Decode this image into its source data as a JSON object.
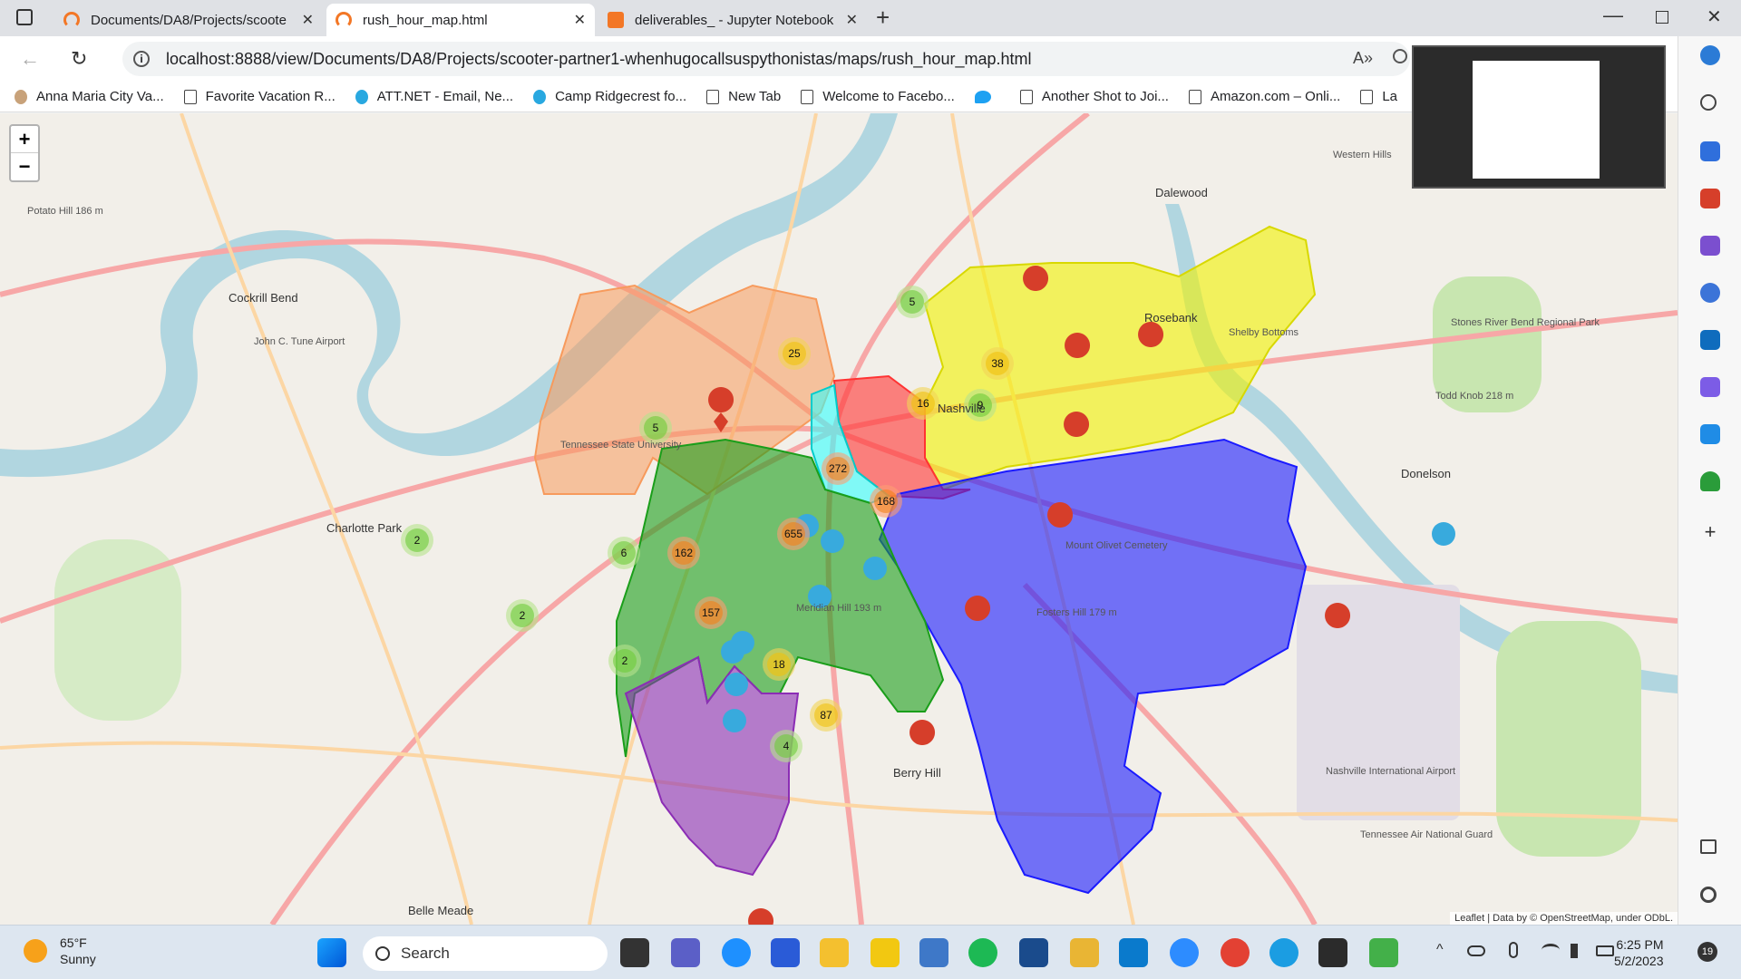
{
  "tabs": [
    {
      "label": "Documents/DA8/Projects/scoote",
      "active": false
    },
    {
      "label": "rush_hour_map.html",
      "active": true
    },
    {
      "label": "deliverables_ - Jupyter Notebook",
      "active": false
    }
  ],
  "address": {
    "url": "localhost:8888/view/Documents/DA8/Projects/scooter-partner1-whenhugocallsuspythonistas/maps/rush_hour_map.html"
  },
  "bookmarks": [
    {
      "label": "Anna Maria City Va...",
      "icon": "circle"
    },
    {
      "label": "Favorite Vacation R...",
      "icon": "page"
    },
    {
      "label": "ATT.NET - Email, Ne...",
      "icon": "globe"
    },
    {
      "label": "Camp Ridgecrest fo...",
      "icon": "globe"
    },
    {
      "label": "New Tab",
      "icon": "page"
    },
    {
      "label": "Welcome to Facebo...",
      "icon": "page"
    },
    {
      "label": "",
      "icon": "twitter-bird"
    },
    {
      "label": "Another Shot to Joi...",
      "icon": "page"
    },
    {
      "label": "Amazon.com – Onli...",
      "icon": "page"
    },
    {
      "label": "La",
      "icon": "page"
    }
  ],
  "map": {
    "zoom_in": "+",
    "zoom_out": "−",
    "attribution": "Leaflet | Data by © OpenStreetMap, under ODbL.",
    "place_labels": [
      "Cockrill Bend",
      "Dalewood",
      "Rosebank",
      "Shelby Bottoms",
      "Donelson",
      "Charlotte Park",
      "Nashville",
      "Tennessee State University",
      "Belle Meade",
      "Berry Hill",
      "Meridian Hill 193 m",
      "Fosters Hill 179 m",
      "Mount Olivet Cemetery",
      "Stones River Bend Regional Park",
      "Nashville International Airport",
      "Tennessee Air National Guard",
      "Potato Hill 186 m",
      "John C. Tune Airport",
      "Todd Knob 218 m",
      "Western Hills"
    ],
    "clusters": [
      {
        "count": "5",
        "size": "small"
      },
      {
        "count": "25",
        "size": "med"
      },
      {
        "count": "38",
        "size": "med"
      },
      {
        "count": "16",
        "size": "med"
      },
      {
        "count": "9",
        "size": "small"
      },
      {
        "count": "5",
        "size": "small"
      },
      {
        "count": "272",
        "size": "large"
      },
      {
        "count": "168",
        "size": "large"
      },
      {
        "count": "655",
        "size": "large"
      },
      {
        "count": "162",
        "size": "large"
      },
      {
        "count": "6",
        "size": "small"
      },
      {
        "count": "2",
        "size": "small"
      },
      {
        "count": "2",
        "size": "small"
      },
      {
        "count": "157",
        "size": "large"
      },
      {
        "count": "2",
        "size": "small"
      },
      {
        "count": "18",
        "size": "med"
      },
      {
        "count": "87",
        "size": "med"
      },
      {
        "count": "4",
        "size": "small"
      }
    ],
    "zone_colors": [
      "#f79a5c",
      "#f2f200",
      "#ff3333",
      "#33ffff",
      "#1a1aff",
      "#1a9e1a",
      "#8b2db5"
    ]
  },
  "taskbar": {
    "weather_temp": "65°F",
    "weather_desc": "Sunny",
    "search_label": "Search",
    "time": "6:25 PM",
    "date": "5/2/2023",
    "notifications": "19"
  }
}
